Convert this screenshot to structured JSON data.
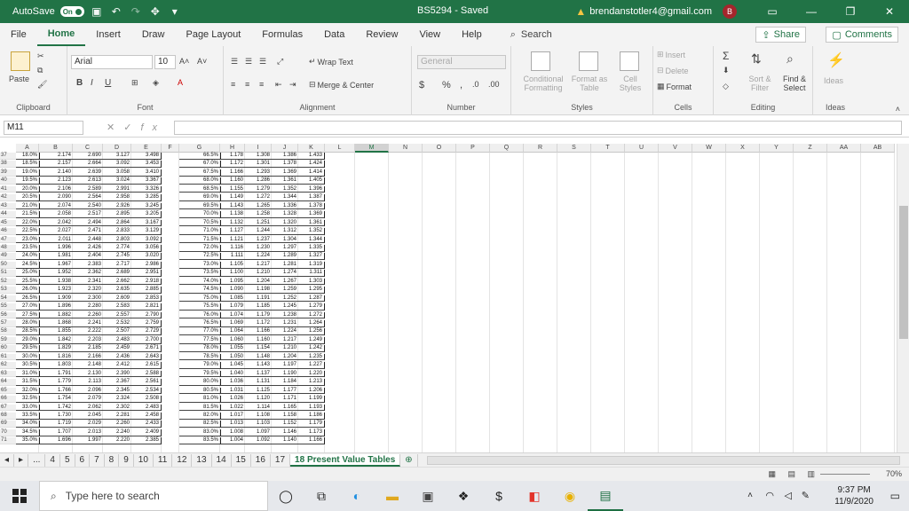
{
  "titlebar": {
    "autosave_label": "AutoSave",
    "autosave_state": "On",
    "document_title": "BS5294  -  Saved",
    "account_email": "brendanstotler4@gmail.com",
    "avatar_initial": "B"
  },
  "menu": {
    "tabs": [
      "File",
      "Home",
      "Insert",
      "Draw",
      "Page Layout",
      "Formulas",
      "Data",
      "Review",
      "View",
      "Help"
    ],
    "active_tab": "Home",
    "search_label": "Search",
    "share_label": "Share",
    "comments_label": "Comments"
  },
  "ribbon": {
    "clipboard": {
      "paste": "Paste",
      "label": "Clipboard"
    },
    "font": {
      "name": "Arial",
      "size": "10",
      "label": "Font",
      "bold": "B",
      "italic": "I",
      "underline": "U"
    },
    "alignment": {
      "wrap": "Wrap Text",
      "merge": "Merge & Center",
      "label": "Alignment"
    },
    "number": {
      "format": "General",
      "currency": "$",
      "percent": "%",
      "comma": ",",
      "label": "Number"
    },
    "styles": {
      "conditional": "Conditional Formatting",
      "format_table": "Format as Table",
      "cell_styles": "Cell Styles",
      "label": "Styles"
    },
    "cells": {
      "insert": "Insert",
      "delete": "Delete",
      "format": "Format",
      "label": "Cells"
    },
    "editing": {
      "sort": "Sort & Filter",
      "find": "Find & Select",
      "label": "Editing"
    },
    "ideas": {
      "ideas": "Ideas",
      "label": "Ideas"
    }
  },
  "formula_bar": {
    "name_box": "M11",
    "fx": "fx",
    "value": ""
  },
  "columns": [
    "A",
    "B",
    "C",
    "D",
    "E",
    "F",
    "G",
    "H",
    "I",
    "J",
    "K",
    "L",
    "M",
    "N",
    "O",
    "P",
    "Q",
    "R",
    "S",
    "T",
    "U",
    "V",
    "W",
    "X",
    "Y",
    "Z",
    "AA",
    "AB"
  ],
  "rows": [
    {
      "n": "37",
      "a": "18.0%",
      "b": "2.174",
      "c": "2.690",
      "d": "3.127",
      "e": "3.498",
      "g": "66.5%",
      "h": "1.178",
      "i": "1.308",
      "j": "1.386",
      "k": "1.433"
    },
    {
      "n": "38",
      "a": "18.5%",
      "b": "2.157",
      "c": "2.664",
      "d": "3.092",
      "e": "3.453",
      "g": "67.0%",
      "h": "1.172",
      "i": "1.301",
      "j": "1.378",
      "k": "1.424"
    },
    {
      "n": "39",
      "a": "19.0%",
      "b": "2.140",
      "c": "2.639",
      "d": "3.058",
      "e": "3.410",
      "g": "67.5%",
      "h": "1.166",
      "i": "1.293",
      "j": "1.369",
      "k": "1.414"
    },
    {
      "n": "40",
      "a": "19.5%",
      "b": "2.123",
      "c": "2.613",
      "d": "3.024",
      "e": "3.367",
      "g": "68.0%",
      "h": "1.160",
      "i": "1.286",
      "j": "1.361",
      "k": "1.405"
    },
    {
      "n": "41",
      "a": "20.0%",
      "b": "2.106",
      "c": "2.589",
      "d": "2.991",
      "e": "3.326",
      "g": "68.5%",
      "h": "1.155",
      "i": "1.279",
      "j": "1.352",
      "k": "1.396"
    },
    {
      "n": "42",
      "a": "20.5%",
      "b": "2.090",
      "c": "2.564",
      "d": "2.958",
      "e": "3.285",
      "g": "69.0%",
      "h": "1.149",
      "i": "1.272",
      "j": "1.344",
      "k": "1.387"
    },
    {
      "n": "43",
      "a": "21.0%",
      "b": "2.074",
      "c": "2.540",
      "d": "2.926",
      "e": "3.245",
      "g": "69.5%",
      "h": "1.143",
      "i": "1.265",
      "j": "1.336",
      "k": "1.378"
    },
    {
      "n": "44",
      "a": "21.5%",
      "b": "2.058",
      "c": "2.517",
      "d": "2.895",
      "e": "3.205",
      "g": "70.0%",
      "h": "1.138",
      "i": "1.258",
      "j": "1.328",
      "k": "1.369"
    },
    {
      "n": "45",
      "a": "22.0%",
      "b": "2.042",
      "c": "2.494",
      "d": "2.864",
      "e": "3.167",
      "g": "70.5%",
      "h": "1.132",
      "i": "1.251",
      "j": "1.320",
      "k": "1.361"
    },
    {
      "n": "46",
      "a": "22.5%",
      "b": "2.027",
      "c": "2.471",
      "d": "2.833",
      "e": "3.129",
      "g": "71.0%",
      "h": "1.127",
      "i": "1.244",
      "j": "1.312",
      "k": "1.352"
    },
    {
      "n": "47",
      "a": "23.0%",
      "b": "2.011",
      "c": "2.448",
      "d": "2.803",
      "e": "3.092",
      "g": "71.5%",
      "h": "1.121",
      "i": "1.237",
      "j": "1.304",
      "k": "1.344"
    },
    {
      "n": "48",
      "a": "23.5%",
      "b": "1.996",
      "c": "2.426",
      "d": "2.774",
      "e": "3.056",
      "g": "72.0%",
      "h": "1.116",
      "i": "1.230",
      "j": "1.297",
      "k": "1.335"
    },
    {
      "n": "49",
      "a": "24.0%",
      "b": "1.981",
      "c": "2.404",
      "d": "2.745",
      "e": "3.020",
      "g": "72.5%",
      "h": "1.111",
      "i": "1.224",
      "j": "1.289",
      "k": "1.327"
    },
    {
      "n": "50",
      "a": "24.5%",
      "b": "1.967",
      "c": "2.383",
      "d": "2.717",
      "e": "2.986",
      "g": "73.0%",
      "h": "1.105",
      "i": "1.217",
      "j": "1.281",
      "k": "1.319"
    },
    {
      "n": "51",
      "a": "25.0%",
      "b": "1.952",
      "c": "2.362",
      "d": "2.689",
      "e": "2.951",
      "g": "73.5%",
      "h": "1.100",
      "i": "1.210",
      "j": "1.274",
      "k": "1.311"
    },
    {
      "n": "52",
      "a": "25.5%",
      "b": "1.938",
      "c": "2.341",
      "d": "2.662",
      "e": "2.918",
      "g": "74.0%",
      "h": "1.095",
      "i": "1.204",
      "j": "1.267",
      "k": "1.303"
    },
    {
      "n": "53",
      "a": "26.0%",
      "b": "1.923",
      "c": "2.320",
      "d": "2.635",
      "e": "2.885",
      "g": "74.5%",
      "h": "1.090",
      "i": "1.198",
      "j": "1.259",
      "k": "1.295"
    },
    {
      "n": "54",
      "a": "26.5%",
      "b": "1.909",
      "c": "2.300",
      "d": "2.609",
      "e": "2.853",
      "g": "75.0%",
      "h": "1.085",
      "i": "1.191",
      "j": "1.252",
      "k": "1.287"
    },
    {
      "n": "55",
      "a": "27.0%",
      "b": "1.896",
      "c": "2.280",
      "d": "2.583",
      "e": "2.821",
      "g": "75.5%",
      "h": "1.079",
      "i": "1.185",
      "j": "1.245",
      "k": "1.279"
    },
    {
      "n": "56",
      "a": "27.5%",
      "b": "1.882",
      "c": "2.260",
      "d": "2.557",
      "e": "2.790",
      "g": "76.0%",
      "h": "1.074",
      "i": "1.179",
      "j": "1.238",
      "k": "1.272"
    },
    {
      "n": "57",
      "a": "28.0%",
      "b": "1.868",
      "c": "2.241",
      "d": "2.532",
      "e": "2.759",
      "g": "76.5%",
      "h": "1.069",
      "i": "1.172",
      "j": "1.231",
      "k": "1.264"
    },
    {
      "n": "58",
      "a": "28.5%",
      "b": "1.855",
      "c": "2.222",
      "d": "2.507",
      "e": "2.729",
      "g": "77.0%",
      "h": "1.064",
      "i": "1.166",
      "j": "1.224",
      "k": "1.256"
    },
    {
      "n": "59",
      "a": "29.0%",
      "b": "1.842",
      "c": "2.203",
      "d": "2.483",
      "e": "2.700",
      "g": "77.5%",
      "h": "1.060",
      "i": "1.160",
      "j": "1.217",
      "k": "1.249"
    },
    {
      "n": "60",
      "a": "29.5%",
      "b": "1.829",
      "c": "2.185",
      "d": "2.459",
      "e": "2.671",
      "g": "78.0%",
      "h": "1.055",
      "i": "1.154",
      "j": "1.210",
      "k": "1.242"
    },
    {
      "n": "61",
      "a": "30.0%",
      "b": "1.816",
      "c": "2.166",
      "d": "2.436",
      "e": "2.643",
      "g": "78.5%",
      "h": "1.050",
      "i": "1.148",
      "j": "1.204",
      "k": "1.235"
    },
    {
      "n": "62",
      "a": "30.5%",
      "b": "1.803",
      "c": "2.148",
      "d": "2.412",
      "e": "2.615",
      "g": "79.0%",
      "h": "1.045",
      "i": "1.143",
      "j": "1.197",
      "k": "1.227"
    },
    {
      "n": "63",
      "a": "31.0%",
      "b": "1.791",
      "c": "2.130",
      "d": "2.390",
      "e": "2.588",
      "g": "79.5%",
      "h": "1.040",
      "i": "1.137",
      "j": "1.190",
      "k": "1.220"
    },
    {
      "n": "64",
      "a": "31.5%",
      "b": "1.779",
      "c": "2.113",
      "d": "2.367",
      "e": "2.561",
      "g": "80.0%",
      "h": "1.036",
      "i": "1.131",
      "j": "1.184",
      "k": "1.213"
    },
    {
      "n": "65",
      "a": "32.0%",
      "b": "1.766",
      "c": "2.096",
      "d": "2.345",
      "e": "2.534",
      "g": "80.5%",
      "h": "1.031",
      "i": "1.125",
      "j": "1.177",
      "k": "1.206"
    },
    {
      "n": "66",
      "a": "32.5%",
      "b": "1.754",
      "c": "2.079",
      "d": "2.324",
      "e": "2.508",
      "g": "81.0%",
      "h": "1.026",
      "i": "1.120",
      "j": "1.171",
      "k": "1.199"
    },
    {
      "n": "67",
      "a": "33.0%",
      "b": "1.742",
      "c": "2.062",
      "d": "2.302",
      "e": "2.483",
      "g": "81.5%",
      "h": "1.022",
      "i": "1.114",
      "j": "1.165",
      "k": "1.193"
    },
    {
      "n": "68",
      "a": "33.5%",
      "b": "1.730",
      "c": "2.045",
      "d": "2.281",
      "e": "2.458",
      "g": "82.0%",
      "h": "1.017",
      "i": "1.108",
      "j": "1.158",
      "k": "1.186"
    },
    {
      "n": "69",
      "a": "34.0%",
      "b": "1.719",
      "c": "2.029",
      "d": "2.260",
      "e": "2.433",
      "g": "82.5%",
      "h": "1.013",
      "i": "1.103",
      "j": "1.152",
      "k": "1.179"
    },
    {
      "n": "70",
      "a": "34.5%",
      "b": "1.707",
      "c": "2.013",
      "d": "2.240",
      "e": "2.409",
      "g": "83.0%",
      "h": "1.008",
      "i": "1.097",
      "j": "1.146",
      "k": "1.173"
    },
    {
      "n": "71",
      "a": "35.0%",
      "b": "1.696",
      "c": "1.997",
      "d": "2.220",
      "e": "2.385",
      "g": "83.5%",
      "h": "1.004",
      "i": "1.092",
      "j": "1.140",
      "k": "1.166"
    }
  ],
  "sheet_tabs": {
    "ellipsis": "...",
    "numbered": [
      "4",
      "5",
      "6",
      "7",
      "8",
      "9",
      "10",
      "11",
      "12",
      "13",
      "14",
      "15",
      "16",
      "17"
    ],
    "active": "18 Present Value Tables"
  },
  "status": {
    "zoom": "70%"
  },
  "taskbar": {
    "search_placeholder": "Type here to search",
    "time": "9:37 PM",
    "date": "11/9/2020"
  }
}
